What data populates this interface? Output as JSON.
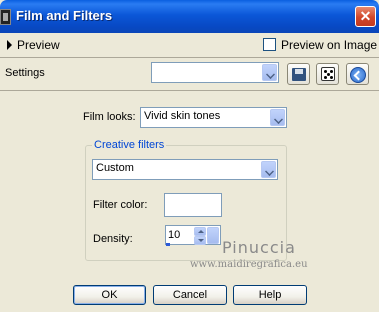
{
  "window": {
    "title": "Film and Filters",
    "close_symbol": "✕",
    "icon": "film-app-icon"
  },
  "preview": {
    "label": "Preview",
    "checkbox_label": "Preview on Image",
    "checkbox_checked": false
  },
  "settings": {
    "label": "Settings",
    "value": "",
    "icons": [
      "save-icon",
      "dice-icon",
      "reset-icon"
    ]
  },
  "film_looks": {
    "label": "Film looks:",
    "value": "Vivid skin tones"
  },
  "creative_filters": {
    "group_title": "Creative filters",
    "value": "Custom",
    "filter_color_label": "Filter color:",
    "filter_color_value": "#ffffff",
    "density_label": "Density:",
    "density_value": "10"
  },
  "watermark": {
    "name": "Pinuccia",
    "url": "www.maidiregrafica.eu"
  },
  "buttons": {
    "ok": "OK",
    "cancel": "Cancel",
    "help": "Help"
  }
}
